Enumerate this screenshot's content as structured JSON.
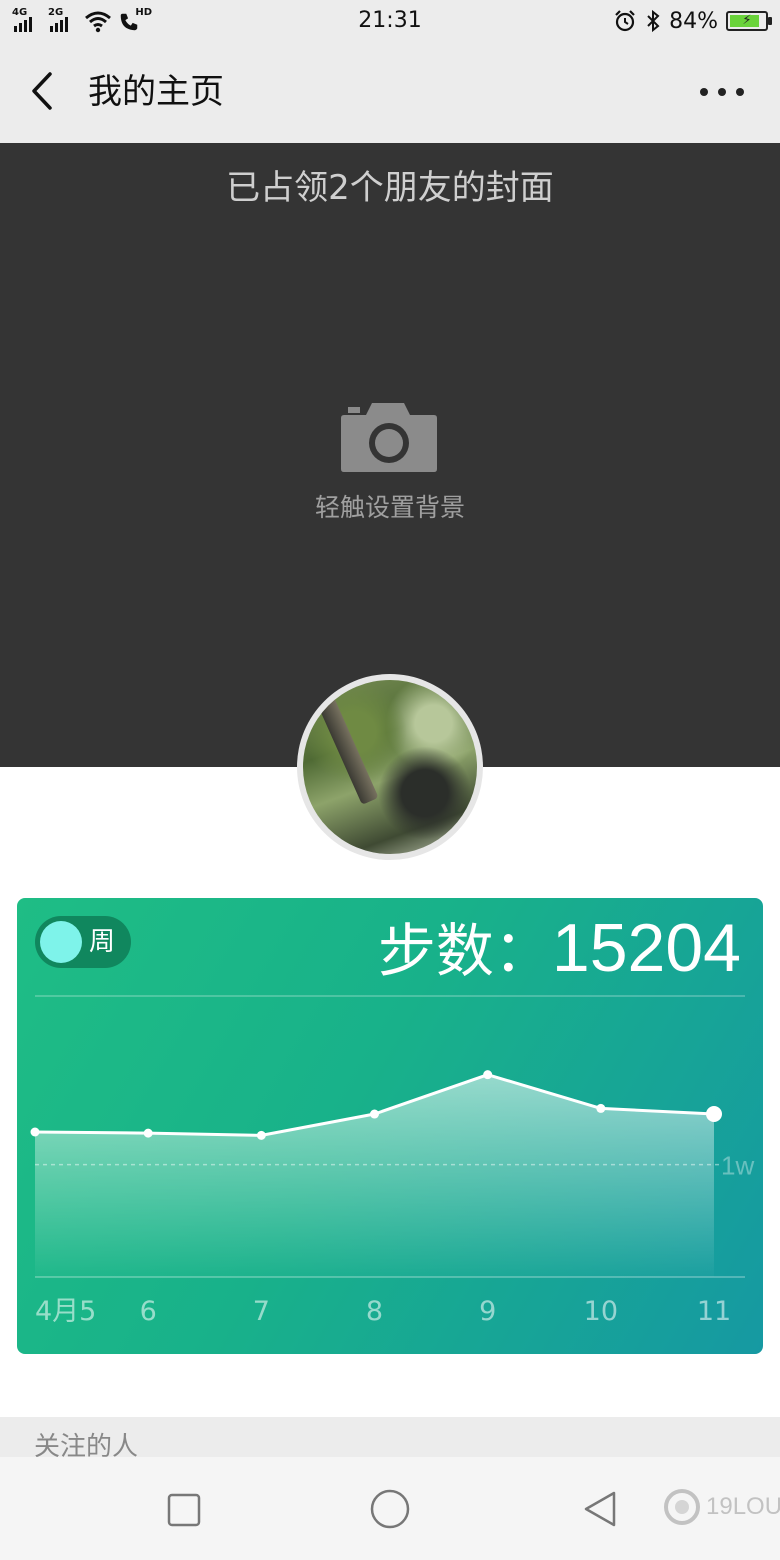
{
  "status_bar": {
    "signal_1": "4G",
    "signal_2": "2G",
    "call_badge": "HD",
    "time": "21:31",
    "battery_percent": "84%",
    "battery_level": 0.84
  },
  "header": {
    "title": "我的主页"
  },
  "cover": {
    "caption": "已占领2个朋友的封面",
    "hint": "轻触设置背景"
  },
  "step_card": {
    "toggle_label": "周",
    "steps_label": "步数：",
    "steps_value": "15204"
  },
  "chart_data": {
    "type": "area",
    "x": [
      "4月5",
      "6",
      "7",
      "8",
      "9",
      "10",
      "11"
    ],
    "values": [
      12900,
      12800,
      12600,
      14500,
      18000,
      15000,
      14500
    ],
    "reference_line": {
      "value": 10000,
      "label": "1w"
    },
    "ylim": [
      0,
      25000
    ],
    "grid": false,
    "colors": {
      "line": "#ffffff",
      "card_start": "#1fbd85",
      "card_end": "#1699a2"
    }
  },
  "following": {
    "label": "关注的人"
  },
  "nav_bar": {
    "watermark": "19LOU"
  },
  "colors": {
    "status_bg": "#ececec",
    "cover_bg": "#343434",
    "accent": "#1fbd85"
  }
}
